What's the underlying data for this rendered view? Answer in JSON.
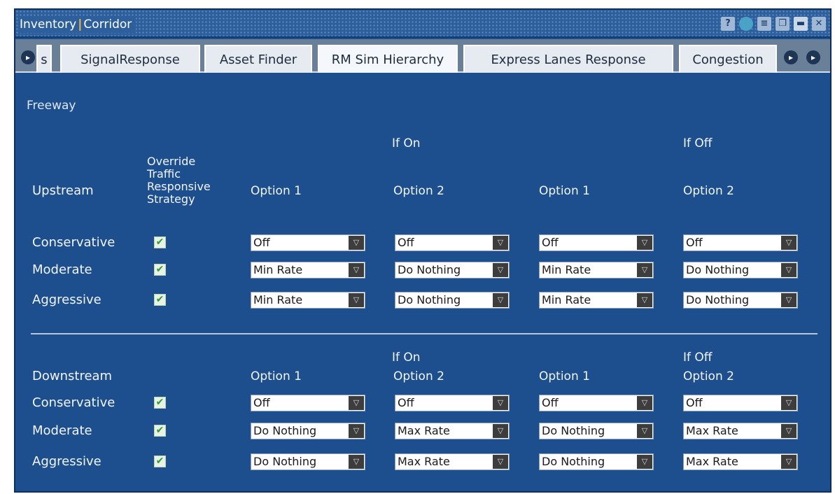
{
  "window": {
    "title_left": "Inventory",
    "title_sep": "|",
    "title_right": "Corridor",
    "controls": [
      {
        "icon": "help-icon",
        "glyph": "?"
      },
      {
        "icon": "globe-icon",
        "glyph": ""
      },
      {
        "icon": "print-icon",
        "glyph": "≡"
      },
      {
        "icon": "copy-icon",
        "glyph": "❐"
      },
      {
        "icon": "minimize-icon",
        "glyph": "▬"
      },
      {
        "icon": "close-icon",
        "glyph": "✕"
      }
    ]
  },
  "tabs": [
    {
      "label": "s",
      "active": false
    },
    {
      "label": "SignalResponse",
      "active": false
    },
    {
      "label": "Asset Finder",
      "active": false
    },
    {
      "label": "RM Sim Hierarchy",
      "active": true
    },
    {
      "label": "Express Lanes Response",
      "active": false
    },
    {
      "label": "Congestion",
      "active": false
    }
  ],
  "nav_glyph": "▸",
  "section_title": "Freeway",
  "check_glyph": "✔",
  "dropdown_glyph": "▽",
  "upstream": {
    "group_on": "If On",
    "group_off": "If Off",
    "label": "Upstream",
    "override_label": "Override Traffic Responsive Strategy",
    "headers": [
      "Option 1",
      "Option 2",
      "Option 1",
      "Option 2"
    ],
    "rows": [
      {
        "label": "Conservative",
        "checked": true,
        "values": [
          "Off",
          "Off",
          "Off",
          "Off"
        ]
      },
      {
        "label": "Moderate",
        "checked": true,
        "values": [
          "Min Rate",
          "Do Nothing",
          "Min Rate",
          "Do Nothing"
        ]
      },
      {
        "label": "Aggressive",
        "checked": true,
        "values": [
          "Min Rate",
          "Do Nothing",
          "Min Rate",
          "Do Nothing"
        ]
      }
    ]
  },
  "downstream": {
    "group_on": "If On",
    "group_off": "If Off",
    "label": "Downstream",
    "headers": [
      "Option 1",
      "Option 2",
      "Option 1",
      "Option 2"
    ],
    "rows": [
      {
        "label": "Conservative",
        "checked": true,
        "values": [
          "Off",
          "Off",
          "Off",
          "Off"
        ]
      },
      {
        "label": "Moderate",
        "checked": true,
        "values": [
          "Do Nothing",
          "Max Rate",
          "Do Nothing",
          "Max Rate"
        ]
      },
      {
        "label": "Aggressive",
        "checked": true,
        "values": [
          "Do Nothing",
          "Max Rate",
          "Do Nothing",
          "Max Rate"
        ]
      }
    ]
  },
  "colors": {
    "panel_bg": "#1d4e8e",
    "title_accent": "#f6b73c",
    "check_green": "#2f9a3a"
  }
}
